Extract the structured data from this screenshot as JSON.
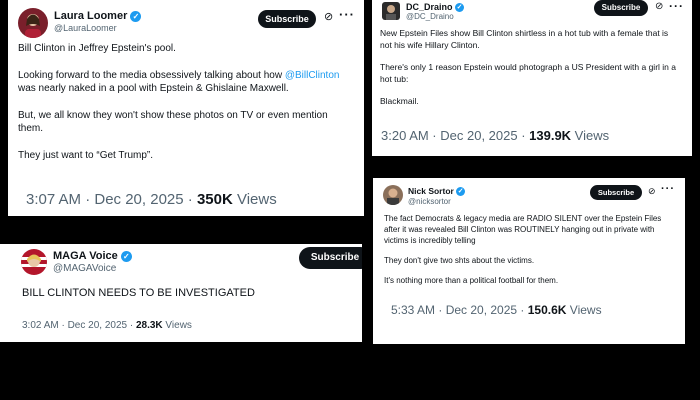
{
  "tweets": [
    {
      "name": "Laura Loomer",
      "handle": "@LauraLoomer",
      "subscribe": "Subscribe",
      "para1": "Bill Clinton in Jeffrey Epstein's pool.",
      "para2_a": "Looking forward to the media obsessively talking about how ",
      "para2_link": "@BillClinton",
      "para2_b": " was nearly naked in a pool with Epstein & Ghislaine Maxwell.",
      "para3": "But, we all know they won't show these photos on TV or even mention them.",
      "para4": "They just want to “Get Trump”.",
      "time": "3:07 AM · Dec 20, 2025 · ",
      "views_count": "350K",
      "views_label": " Views"
    },
    {
      "name": "DC_Draino",
      "handle": "@DC_Draino",
      "subscribe": "Subscribe",
      "para1": "New Epstein Files show Bill Clinton shirtless in a hot tub with a female that is not his wife Hillary Clinton.",
      "para2": "There's only 1 reason Epstein would photograph a US President with a girl in a hot tub:",
      "para3": "Blackmail.",
      "time": "3:20 AM · Dec 20, 2025 · ",
      "views_count": "139.9K",
      "views_label": " Views"
    },
    {
      "name": "MAGA Voice",
      "handle": "@MAGAVoice",
      "subscribe": "Subscribe",
      "para1": "BILL CLINTON NEEDS TO BE INVESTIGATED",
      "time": "3:02 AM · Dec 20, 2025 · ",
      "views_count": "28.3K",
      "views_label": " Views"
    },
    {
      "name": "Nick Sortor",
      "handle": "@nicksortor",
      "subscribe": "Subscribe",
      "para1": "The fact Democrats & legacy media are RADIO SILENT over the Epstein Files after it was revealed Bill Clinton was ROUTINELY hanging out in private with victims is incredibly telling",
      "para2": "They don't give two shts about the victims.",
      "para3": "It's nothing more than a political football for them.",
      "time": "5:33 AM · Dec 20, 2025 · ",
      "views_count": "150.6K",
      "views_label": " Views"
    }
  ],
  "icons": {
    "verified": "✓",
    "grok": "⊘",
    "more": "···"
  },
  "colors": {
    "background": "#000000",
    "card": "#ffffff",
    "link": "#1d9bf0",
    "verified": "#1d9bf0",
    "muted": "#536471",
    "button": "#0f1419"
  }
}
